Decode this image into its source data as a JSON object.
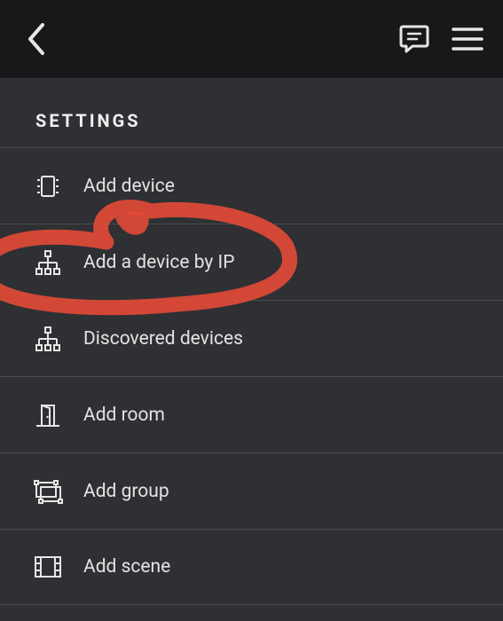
{
  "header_title": "SETTINGS",
  "items": [
    {
      "label": "Add device",
      "icon": "device-icon"
    },
    {
      "label": "Add a device by IP",
      "icon": "network-icon"
    },
    {
      "label": "Discovered devices",
      "icon": "network-icon"
    },
    {
      "label": "Add room",
      "icon": "door-icon"
    },
    {
      "label": "Add group",
      "icon": "group-icon"
    },
    {
      "label": "Add scene",
      "icon": "scene-icon"
    }
  ],
  "annotation_color": "#e14a36",
  "annotated_index": 1
}
